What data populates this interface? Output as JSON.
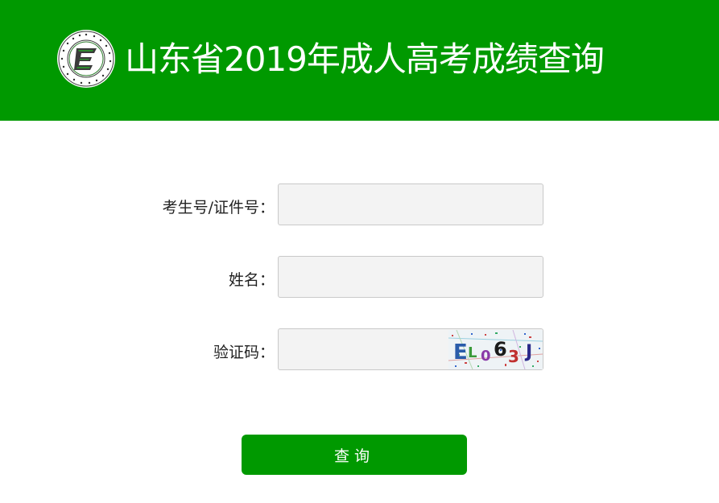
{
  "header": {
    "title": "山东省2019年成人高考成绩查询",
    "logo_letter": "E",
    "logo_text": "Shandong Education Admission & Examination · 山东教育招生考试",
    "color": "#009900"
  },
  "form": {
    "candidate_id_label": "考生号/证件号：",
    "candidate_id_value": "",
    "name_label": "姓名：",
    "name_value": "",
    "captcha_label": "验证码：",
    "captcha_value": "",
    "captcha_image_text": "EL063J"
  },
  "submit_button": {
    "label": "查询",
    "color": "#009900"
  }
}
